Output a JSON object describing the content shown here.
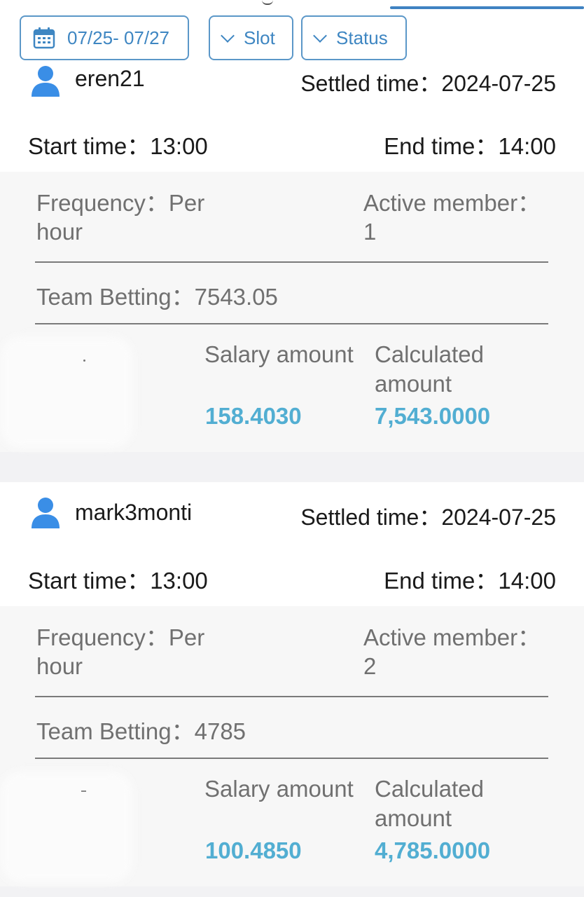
{
  "filters": {
    "date_range": "07/25- 07/27",
    "slot_label": "Slot",
    "status_label": "Status"
  },
  "labels": {
    "settled_time": "Settled time：",
    "start_time": "Start time：",
    "end_time": "End time：",
    "frequency": "Frequency：",
    "active_member": "Active member：",
    "team_betting": "Team Betting：",
    "salary_amount": "Salary amount",
    "calculated_amount": "Calculated amount"
  },
  "records": [
    {
      "username": "eren21",
      "settled_time": "2024-07-25",
      "start_time": "13:00",
      "end_time": "14:00",
      "frequency": "Per hour",
      "active_member": "1",
      "team_betting": "7543.05",
      "salary_amount": "158.4030",
      "calculated_amount": "7,543.0000"
    },
    {
      "username": "mark3monti",
      "settled_time": "2024-07-25",
      "start_time": "13:00",
      "end_time": "14:00",
      "frequency": "Per hour",
      "active_member": "2",
      "team_betting": "4785",
      "salary_amount": "100.4850",
      "calculated_amount": "4,785.0000"
    }
  ],
  "colors": {
    "accent": "#3f82c2",
    "value": "#52aed2",
    "icon": "#3a8ee6"
  },
  "icons": {
    "calendar": "calendar-icon",
    "chevron": "chevron-down-icon",
    "user": "user-icon"
  }
}
